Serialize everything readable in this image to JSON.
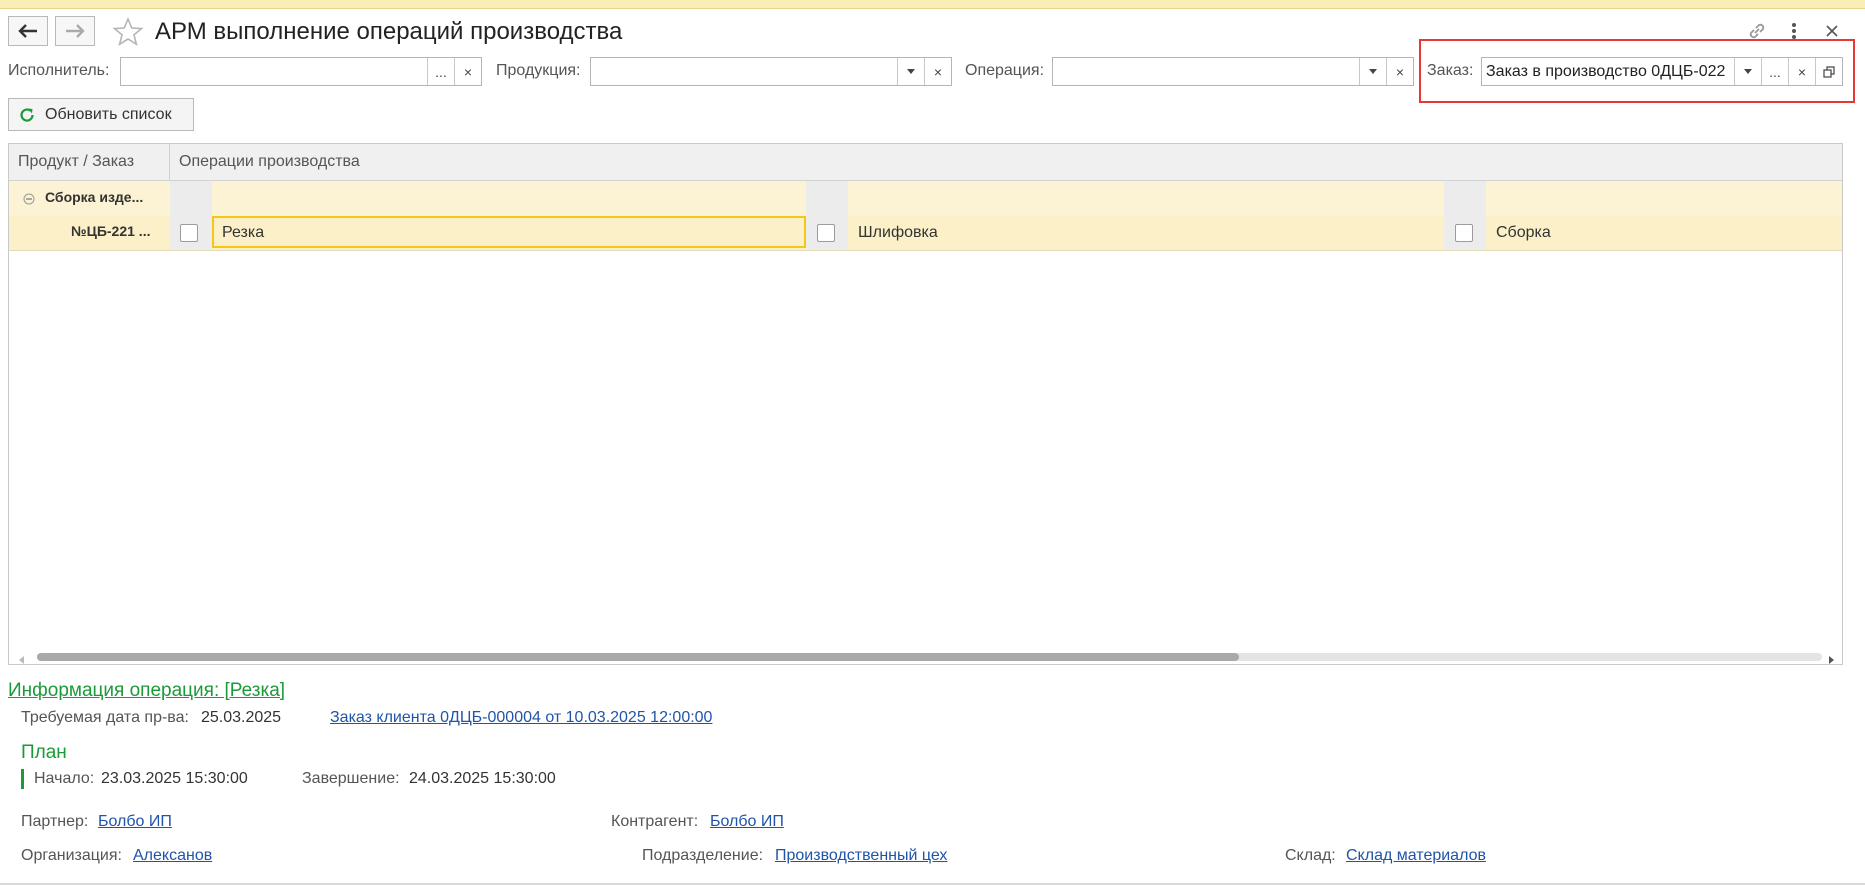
{
  "header": {
    "title": "АРМ выполнение операций производства"
  },
  "filters": {
    "executor_label": "Исполнитель:",
    "executor_value": "",
    "product_label": "Продукция:",
    "product_value": "",
    "operation_label": "Операция:",
    "operation_value": "",
    "order_label": "Заказ:",
    "order_value": "Заказ в производство 0ДЦБ-022",
    "choose_label": "...",
    "clear_label": "×"
  },
  "toolbar": {
    "refresh_label": "Обновить список"
  },
  "grid": {
    "columns": [
      "Продукт / Заказ",
      "Операции производства"
    ],
    "group_label": "Сборка изде...",
    "order_label": "№ЦБ-221 ...",
    "operations": [
      {
        "name": "Резка",
        "checked": false,
        "selected": true
      },
      {
        "name": "Шлифовка",
        "checked": false,
        "selected": false
      },
      {
        "name": "Сборка",
        "checked": false,
        "selected": false
      }
    ]
  },
  "info": {
    "title": "Информация операция:  [Резка]",
    "required_date_label": "Требуемая дата пр-ва:",
    "required_date_value": "25.03.2025",
    "client_order_link": "Заказ клиента 0ДЦБ-000004 от 10.03.2025 12:00:00",
    "plan_title": "План",
    "start_label": "Начало:",
    "start_value": "23.03.2025 15:30:00",
    "end_label": "Завершение:",
    "end_value": "24.03.2025 15:30:00",
    "partner_label": "Партнер:",
    "partner_value": "Болбо ИП",
    "counterparty_label": "Контрагент:",
    "counterparty_value": "Болбо ИП",
    "organization_label": "Организация:",
    "organization_value": "Алексанов",
    "department_label": "Подразделение:",
    "department_value": "Производственный цех",
    "warehouse_label": "Склад:",
    "warehouse_value": "Склад материалов"
  },
  "colors": {
    "accent_green": "#1b9a39",
    "link_blue": "#2054a8",
    "row_highlight": "#fbf0c7",
    "focus_border": "#f5c518",
    "annotation_red": "#e53935"
  }
}
